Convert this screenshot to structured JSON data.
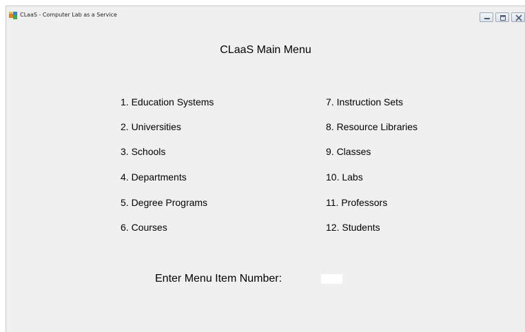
{
  "window": {
    "title": "CLaaS - Computer Lab as a Service",
    "icon": "app-icon",
    "controls": [
      "minimize-icon",
      "maximize-icon",
      "close-icon"
    ]
  },
  "main": {
    "title": "CLaaS Main Menu",
    "menu_left": [
      "1.  Education Systems",
      "2.  Universities",
      "3.  Schools",
      "4.  Departments",
      "5.  Degree Programs",
      "6.  Courses"
    ],
    "menu_right": [
      "7.  Instruction Sets",
      "8.  Resource Libraries",
      "9.  Classes",
      "10.  Labs",
      "11.  Professors",
      "12.  Students"
    ],
    "prompt_label": "Enter Menu Item Number:",
    "prompt_value": ""
  },
  "colors": {
    "background": "#f0f0f0",
    "text": "#000000"
  }
}
